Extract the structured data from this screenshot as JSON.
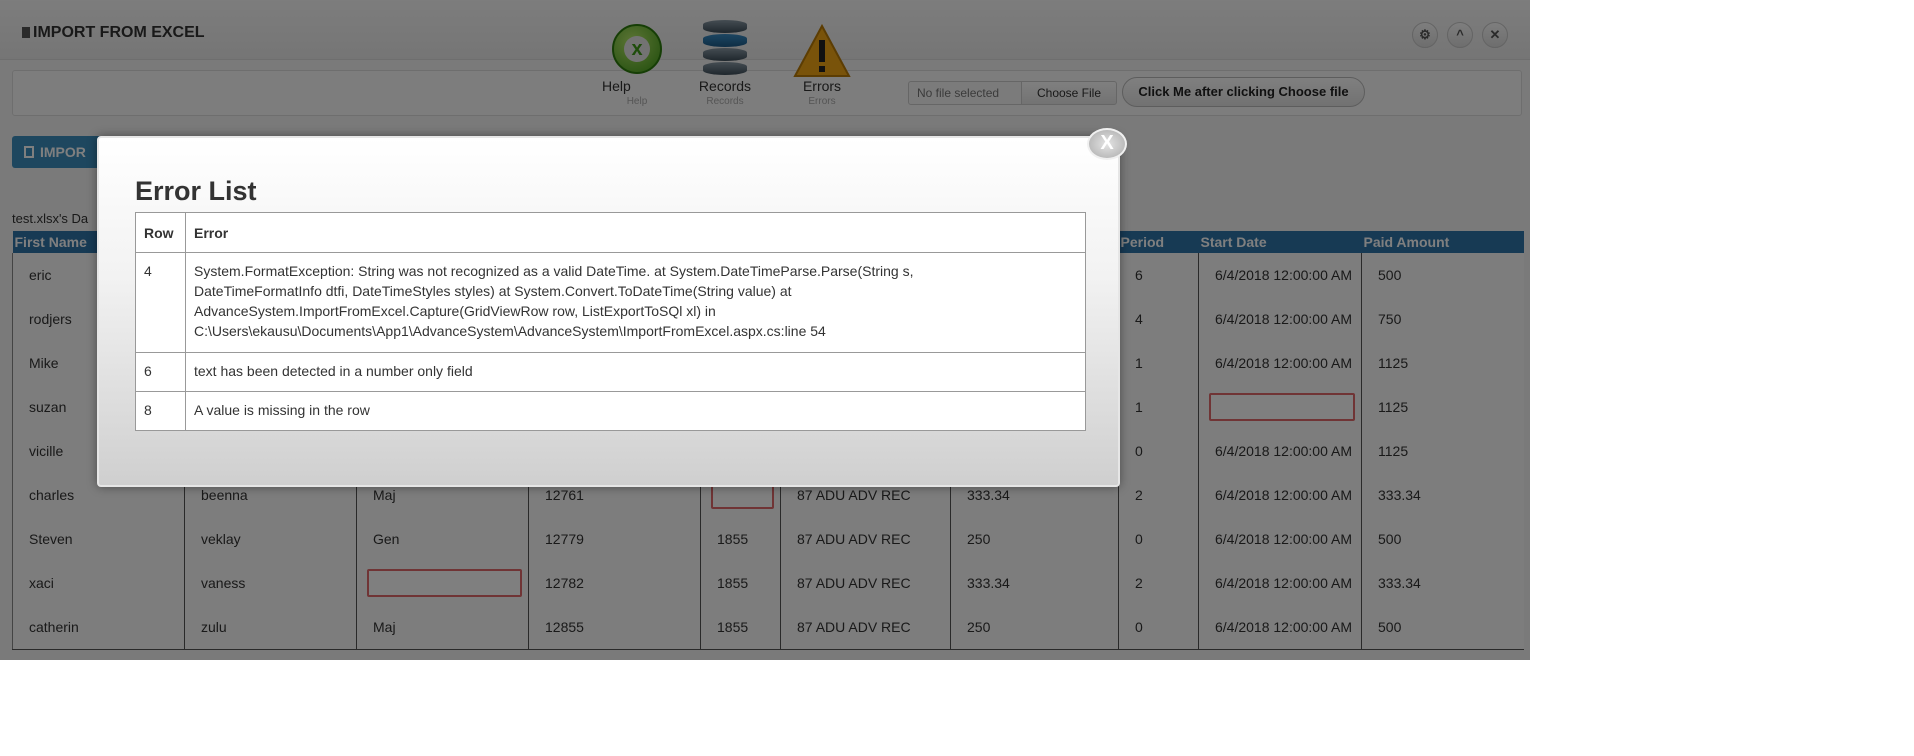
{
  "panel": {
    "title": "IMPORT FROM EXCEL",
    "icons": [
      "settings-icon",
      "collapse-icon",
      "close-icon"
    ],
    "settings_glyph": "⚙",
    "collapse_glyph": "^",
    "close_glyph": "✕"
  },
  "toolbar": {
    "help": {
      "label": "Help",
      "sublabel": "Help",
      "icon": "help-icon",
      "icon_glyph": "x"
    },
    "records": {
      "label": "Records",
      "sublabel": "Records",
      "icon": "database-icon"
    },
    "errors": {
      "label": "Errors",
      "sublabel": "Errors",
      "icon": "warning-icon"
    },
    "file_status": "No file selected",
    "choose_file_label": "Choose File",
    "click_me_label": "Click Me after clicking Choose file"
  },
  "import_button_label": "IMPOR",
  "grid": {
    "caption": "test.xlsx's Da",
    "headers": [
      "First Name",
      "",
      "",
      "",
      "",
      "",
      "",
      "Period",
      "Start Date",
      "Paid Amount"
    ],
    "rows": [
      [
        "eric",
        "",
        "",
        "",
        "",
        "",
        "",
        "6",
        "6/4/2018 12:00:00 AM",
        "500"
      ],
      [
        "rodjers",
        "",
        "",
        "",
        "",
        "",
        "",
        "4",
        "6/4/2018 12:00:00 AM",
        "750"
      ],
      [
        "Mike",
        "",
        "",
        "",
        "",
        "",
        "",
        "1",
        "6/4/2018 12:00:00 AM",
        "1125"
      ],
      [
        "suzan",
        "",
        "",
        "",
        "",
        "",
        "",
        "1",
        "",
        "1125"
      ],
      [
        "vicille",
        "",
        "",
        "",
        "",
        "",
        "",
        "0",
        "6/4/2018 12:00:00 AM",
        "1125"
      ],
      [
        "charles",
        "beenna",
        "Maj",
        "12761",
        "",
        "87 ADU ADV REC",
        "333.34",
        "2",
        "6/4/2018 12:00:00 AM",
        "333.34"
      ],
      [
        "Steven",
        "veklay",
        "Gen",
        "12779",
        "1855",
        "87 ADU ADV REC",
        "250",
        "0",
        "6/4/2018 12:00:00 AM",
        "500"
      ],
      [
        "xaci",
        "vaness",
        "",
        "12782",
        "1855",
        "87 ADU ADV REC",
        "333.34",
        "2",
        "6/4/2018 12:00:00 AM",
        "333.34"
      ],
      [
        "catherin",
        "zulu",
        "Maj",
        "12855",
        "1855",
        "87 ADU ADV REC",
        "250",
        "0",
        "6/4/2018 12:00:00 AM",
        "500"
      ]
    ]
  },
  "modal": {
    "title": "Error List",
    "close_glyph": "X",
    "headers": [
      "Row",
      "Error"
    ],
    "rows": [
      {
        "row": "4",
        "error": "System.FormatException: String was not recognized as a valid DateTime. at System.DateTimeParse.Parse(String s, DateTimeFormatInfo dtfi, DateTimeStyles styles) at System.Convert.ToDateTime(String value) at AdvanceSystem.ImportFromExcel.Capture(GridViewRow row, ListExportToSQl xl) in C:\\Users\\ekausu\\Documents\\App1\\AdvanceSystem\\AdvanceSystem\\ImportFromExcel.aspx.cs:line 54"
      },
      {
        "row": "6",
        "error": "text has been detected in a number only field"
      },
      {
        "row": "8",
        "error": "A value is missing in the row"
      }
    ]
  }
}
